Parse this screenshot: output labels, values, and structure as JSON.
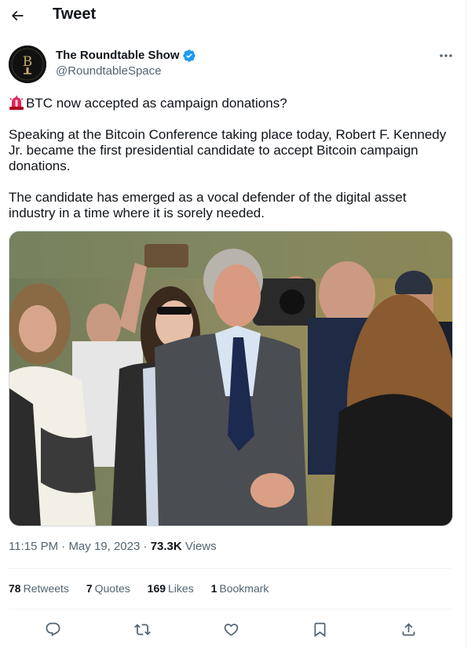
{
  "header": {
    "title": "Tweet",
    "back_icon": "arrow-left-icon"
  },
  "author": {
    "display_name": "The Roundtable Show",
    "handle": "@RoundtableSpace",
    "verified": true,
    "verified_color": "#1d9bf0",
    "avatar_bg": "#111111"
  },
  "tweet": {
    "headline": "BTC now accepted as campaign donations?",
    "headline_icon": "siren-emoji",
    "paragraph_1": "Speaking at the Bitcoin Conference taking place today, Robert F. Kennedy Jr. became the first presidential candidate to accept Bitcoin campaign donations.",
    "paragraph_2": "The candidate has emerged as a vocal defender of the digital asset industry in a time where it is sorely needed."
  },
  "meta": {
    "time": "11:15 PM",
    "sep1": " · ",
    "date": "May 19, 2023",
    "sep2": " · ",
    "views_count": "73.3K",
    "views_label": " Views"
  },
  "stats": {
    "retweets_count": "78",
    "retweets_label": "Retweets",
    "quotes_count": "7",
    "quotes_label": "Quotes",
    "likes_count": "169",
    "likes_label": "Likes",
    "bookmarks_count": "1",
    "bookmarks_label": "Bookmark"
  },
  "actions": {
    "reply_icon": "reply-icon",
    "retweet_icon": "retweet-icon",
    "like_icon": "heart-icon",
    "bookmark_icon": "bookmark-icon",
    "share_icon": "share-icon"
  },
  "colors": {
    "text": "#0f1419",
    "secondary": "#536471",
    "divider": "#eff3f4",
    "accent": "#1d9bf0"
  }
}
